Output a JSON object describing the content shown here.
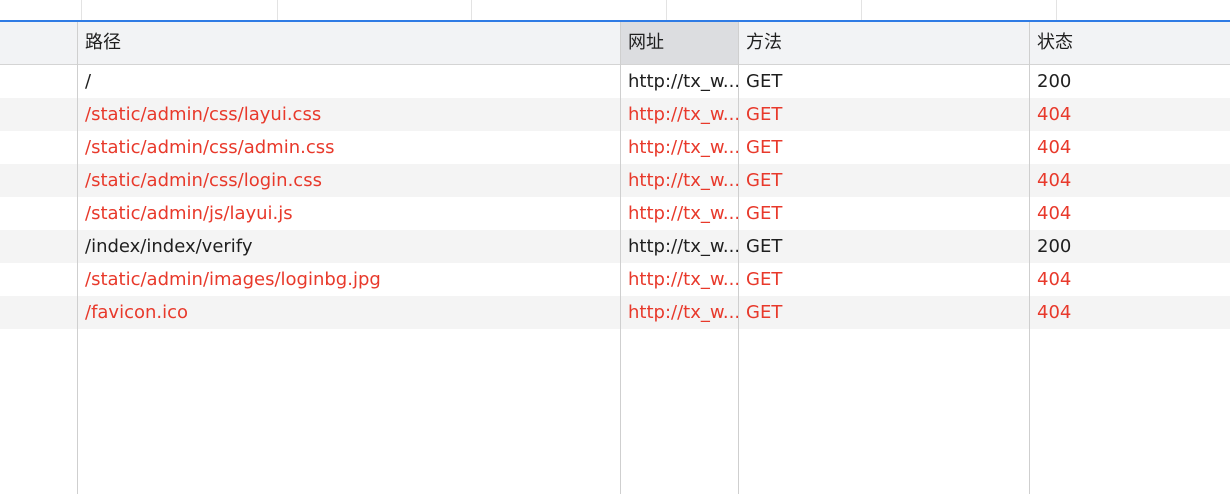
{
  "accent_color": "#2f7be4",
  "error_color": "#e8392b",
  "columns": {
    "path": "路径",
    "url": "网址",
    "method": "方法",
    "status": "状态"
  },
  "rows": [
    {
      "path": "/",
      "url": "http://tx_w...",
      "method": "GET",
      "status": "200",
      "state": "ok"
    },
    {
      "path": "/static/admin/css/layui.css",
      "url": "http://tx_w...",
      "method": "GET",
      "status": "404",
      "state": "err"
    },
    {
      "path": "/static/admin/css/admin.css",
      "url": "http://tx_w...",
      "method": "GET",
      "status": "404",
      "state": "err"
    },
    {
      "path": "/static/admin/css/login.css",
      "url": "http://tx_w...",
      "method": "GET",
      "status": "404",
      "state": "err"
    },
    {
      "path": "/static/admin/js/layui.js",
      "url": "http://tx_w...",
      "method": "GET",
      "status": "404",
      "state": "err"
    },
    {
      "path": "/index/index/verify",
      "url": "http://tx_w...",
      "method": "GET",
      "status": "200",
      "state": "ok"
    },
    {
      "path": "/static/admin/images/loginbg.jpg",
      "url": "http://tx_w...",
      "method": "GET",
      "status": "404",
      "state": "err"
    },
    {
      "path": "/favicon.ico",
      "url": "http://tx_w...",
      "method": "GET",
      "status": "404",
      "state": "err"
    }
  ]
}
